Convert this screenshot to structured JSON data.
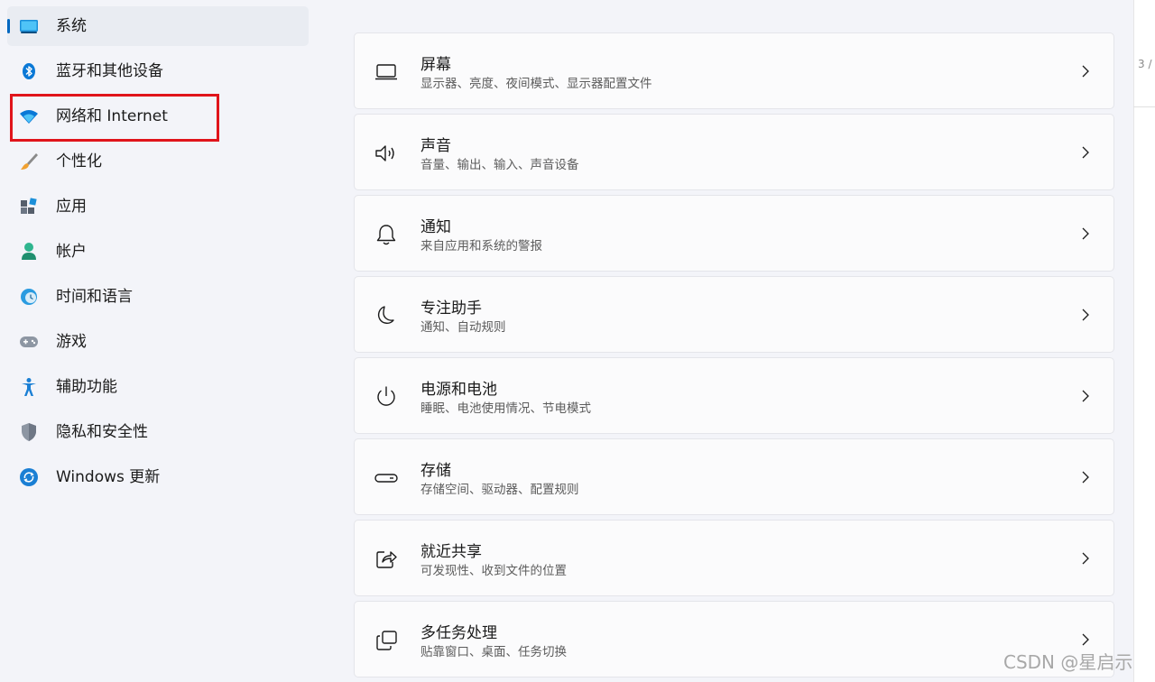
{
  "sidebar": {
    "items": [
      {
        "label": "系统",
        "icon": "system-display-icon",
        "selected": true
      },
      {
        "label": "蓝牙和其他设备",
        "icon": "bluetooth-icon"
      },
      {
        "label": "网络和 Internet",
        "icon": "wifi-icon"
      },
      {
        "label": "个性化",
        "icon": "paintbrush-icon"
      },
      {
        "label": "应用",
        "icon": "apps-icon"
      },
      {
        "label": "帐户",
        "icon": "account-icon"
      },
      {
        "label": "时间和语言",
        "icon": "time-language-icon"
      },
      {
        "label": "游戏",
        "icon": "gamepad-icon"
      },
      {
        "label": "辅助功能",
        "icon": "accessibility-icon"
      },
      {
        "label": "隐私和安全性",
        "icon": "shield-icon"
      },
      {
        "label": "Windows 更新",
        "icon": "windows-update-icon"
      }
    ]
  },
  "main": {
    "cards": [
      {
        "title": "屏幕",
        "desc": "显示器、亮度、夜间模式、显示器配置文件",
        "icon": "display-icon"
      },
      {
        "title": "声音",
        "desc": "音量、输出、输入、声音设备",
        "icon": "speaker-icon"
      },
      {
        "title": "通知",
        "desc": "来自应用和系统的警报",
        "icon": "bell-icon"
      },
      {
        "title": "专注助手",
        "desc": "通知、自动规则",
        "icon": "moon-icon"
      },
      {
        "title": "电源和电池",
        "desc": "睡眠、电池使用情况、节电模式",
        "icon": "power-icon"
      },
      {
        "title": "存储",
        "desc": "存储空间、驱动器、配置规则",
        "icon": "storage-drive-icon"
      },
      {
        "title": "就近共享",
        "desc": "可发现性、收到文件的位置",
        "icon": "share-icon"
      },
      {
        "title": "多任务处理",
        "desc": "贴靠窗口、桌面、任务切换",
        "icon": "multitasking-icon"
      }
    ]
  },
  "edge_text": "3 /",
  "watermark": "CSDN @星启示",
  "colors": {
    "accent": "#0067c0",
    "highlight_border": "#e0141b",
    "background": "#f3f4f9",
    "card": "#fbfbfc"
  }
}
